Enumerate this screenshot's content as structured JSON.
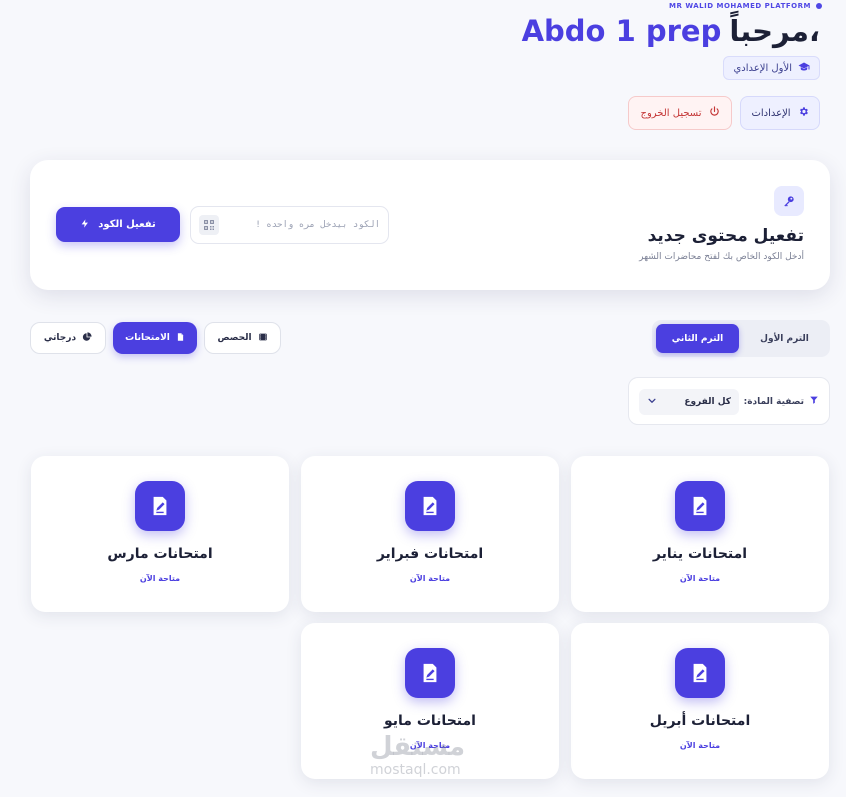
{
  "header": {
    "platform_name": "MR WALID MOHAMED PLATFORM",
    "greeting": "مرحباً،",
    "user_name": "Abdo 1 prep",
    "grade": "الأول الإعدادي",
    "settings_label": "الإعدادات",
    "logout_label": "تسجيل الخروج"
  },
  "activation": {
    "title": "تفعيل محتوى جديد",
    "subtitle": "أدخل الكود الخاص بك لفتح محاضرات الشهر",
    "input_placeholder": "الكود بيدخل مره واحده !",
    "button_label": "تفعيل الكود"
  },
  "terms": {
    "first": "الترم الأول",
    "second": "الترم الثاني",
    "selected": "second"
  },
  "tabs": {
    "lessons": "الحصص",
    "exams": "الامتحانات",
    "grades": "درجاتي",
    "selected": "exams"
  },
  "filter": {
    "label": "تصفية المادة:",
    "selected": "كل الفروع"
  },
  "exams": [
    {
      "title": "امتحانات يناير",
      "status": "متاحة الآن"
    },
    {
      "title": "امتحانات فبراير",
      "status": "متاحة الآن"
    },
    {
      "title": "امتحانات مارس",
      "status": "متاحة الآن"
    },
    {
      "title": "امتحانات أبريل",
      "status": "متاحة الآن"
    },
    {
      "title": "امتحانات مايو",
      "status": "متاحة الآن"
    }
  ],
  "watermark": {
    "text": "مستقل",
    "sub": "mostaql.com"
  },
  "colors": {
    "accent": "#4b3fe0",
    "danger": "#c43535",
    "background": "#f7f8fc"
  }
}
